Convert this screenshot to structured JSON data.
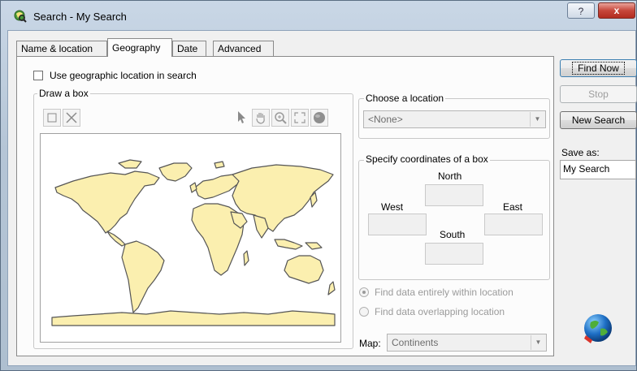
{
  "window": {
    "title": "Search - My Search",
    "help_label": "?",
    "close_label": "x"
  },
  "tabs": [
    {
      "label": "Name & location",
      "active": false
    },
    {
      "label": "Geography",
      "active": true
    },
    {
      "label": "Date",
      "active": false
    },
    {
      "label": "Advanced",
      "active": false
    }
  ],
  "geography": {
    "use_location_label": "Use geographic location in search",
    "use_location_checked": false,
    "draw_box": {
      "title": "Draw a box",
      "tools": [
        "box-select-icon",
        "clear-icon",
        "pointer-icon",
        "pan-hand-icon",
        "zoom-in-icon",
        "full-extent-icon",
        "globe-view-icon"
      ]
    },
    "choose_location": {
      "title": "Choose a location",
      "selected": "<None>"
    },
    "coordinates": {
      "title": "Specify coordinates of a box",
      "north_label": "North",
      "west_label": "West",
      "east_label": "East",
      "south_label": "South",
      "north_value": "",
      "west_value": "",
      "east_value": "",
      "south_value": ""
    },
    "options": [
      {
        "label": "Find data entirely within location",
        "selected": true
      },
      {
        "label": "Find data overlapping location",
        "selected": false
      }
    ],
    "map_label": "Map:",
    "map_selected": "Continents"
  },
  "actions": {
    "find_now": "Find Now",
    "stop": "Stop",
    "new_search": "New Search",
    "save_as_label": "Save as:",
    "save_as_value": "My Search"
  },
  "colors": {
    "land": "#fbefaf",
    "land_outline": "#555555",
    "close_button": "#c6463a"
  }
}
